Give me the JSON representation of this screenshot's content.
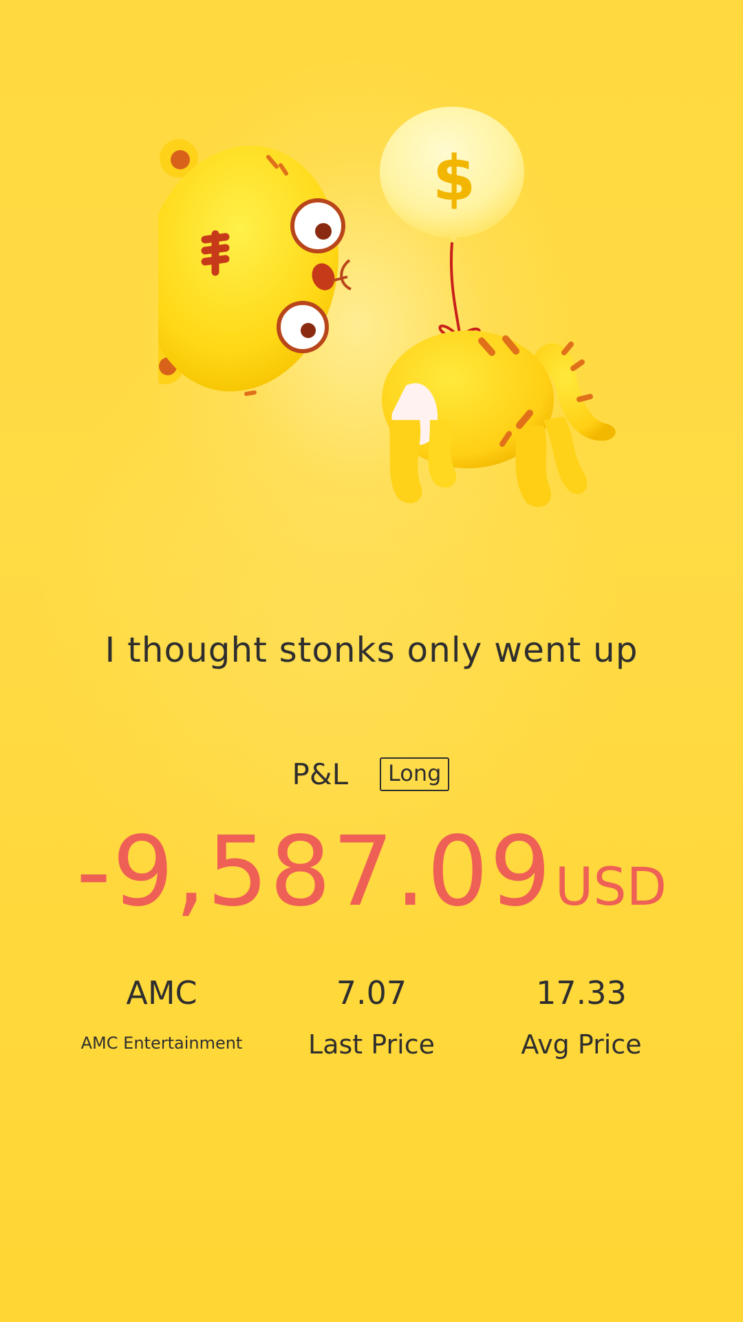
{
  "caption": "I thought stonks only went up",
  "pnl": {
    "label": "P&L",
    "position_badge": "Long",
    "amount": "-9,587.09",
    "currency": "USD",
    "color": "#ee5f55"
  },
  "stats": [
    {
      "value": "AMC",
      "label": "AMC Entertainment"
    },
    {
      "value": "7.07",
      "label": "Last Price"
    },
    {
      "value": "17.33",
      "label": "Avg Price"
    }
  ],
  "illustration": {
    "icon": "tiger-balloon-icon",
    "balloon_symbol": "$"
  },
  "colors": {
    "background": "#ffd93f",
    "text": "#2e2e2e",
    "loss": "#ee5f55"
  }
}
